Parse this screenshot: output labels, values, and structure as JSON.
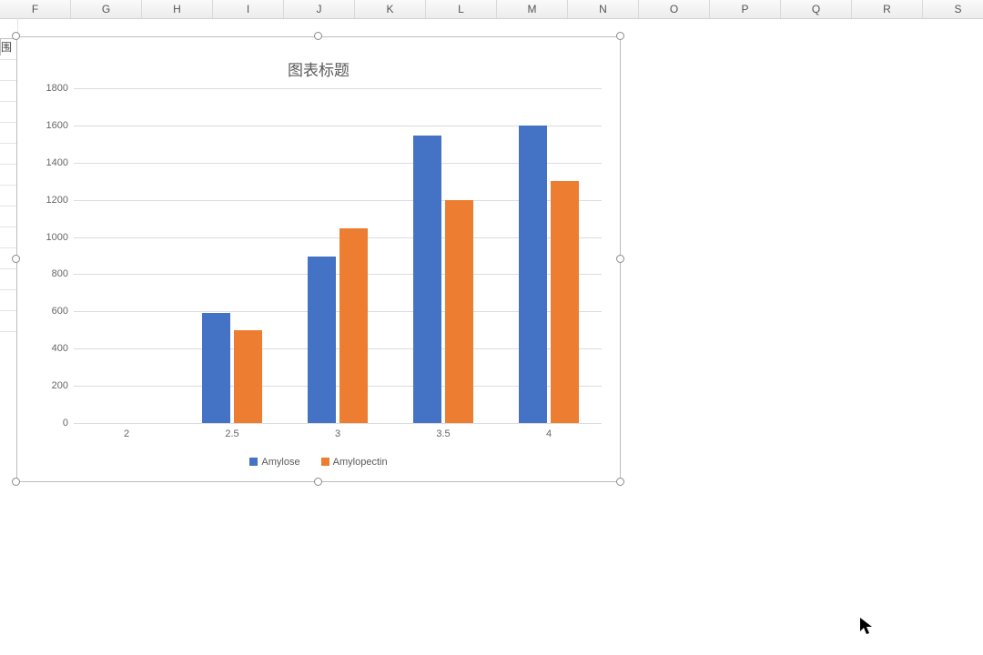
{
  "columns": [
    "F",
    "G",
    "H",
    "I",
    "J",
    "K",
    "L",
    "M",
    "N",
    "O",
    "P",
    "Q",
    "R",
    "S"
  ],
  "cell_fragment_left": "围",
  "cell_fragment": "Amylopectin范围",
  "chart_data": {
    "type": "bar",
    "title": "图表标题",
    "xlabel": "",
    "ylabel": "",
    "ylim": [
      0,
      1800
    ],
    "ytick_step": 200,
    "categories": [
      "2",
      "2.5",
      "3",
      "3.5",
      "4"
    ],
    "series": [
      {
        "name": "Amylose",
        "color": "#4472C4",
        "values": [
          0,
          590,
          895,
          1545,
          1600
        ]
      },
      {
        "name": "Amylopectin",
        "color": "#ED7D31",
        "values": [
          0,
          500,
          1045,
          1200,
          1300
        ]
      }
    ],
    "legend_position": "bottom",
    "grid": true
  },
  "cursor": {
    "left": 944,
    "top": 678
  }
}
